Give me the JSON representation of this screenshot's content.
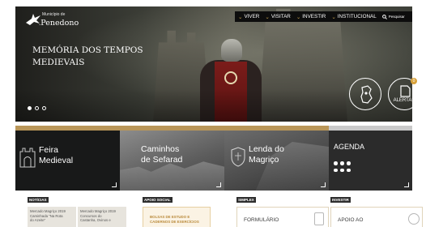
{
  "header": {
    "logo_small": "Município de",
    "logo_name": "Penedono",
    "nav": [
      {
        "label": "VIVER"
      },
      {
        "label": "VISITAR"
      },
      {
        "label": "INVESTIR"
      },
      {
        "label": "INSTITUCIONAL"
      }
    ],
    "search_label": "Pesquisar"
  },
  "hero": {
    "title_line1": "MEMÓRIA DOS TEMPOS",
    "title_line2": "MEDIEVAIS",
    "slides": 3,
    "active_slide": 1,
    "alert_label": "ALERTAS",
    "alert_count": "0"
  },
  "tiles": [
    {
      "line1": "Feira",
      "line2": "Medieval"
    },
    {
      "line1": "Caminhos",
      "line2": "de Sefarad"
    },
    {
      "line1": "Lenda do",
      "line2": "Magriço"
    },
    {
      "line1": "AGENDA",
      "line2": ""
    }
  ],
  "sections": {
    "news_label": "NOTÍCIAS",
    "news": [
      {
        "line1": "Mercado Magriço 2019",
        "line2": "Caminhada \"Na Rota",
        "line3": "do Azeite\""
      },
      {
        "line1": "Mercado Magriço 2019",
        "line2": "Concursos do",
        "line3": "Castanha, Ovinos e"
      }
    ],
    "social_label": "APOIO SOCIAL",
    "social_card_line1": "BOLSAS DE ESTUDO E",
    "social_card_line2": "CADERNOS DE EXERCÍCIOS",
    "simplex_label": "SIMPLEX",
    "simplex_card": "FORMULÁRIO",
    "investir_label": "INVESTIR",
    "investir_card": "APOIO AO"
  },
  "colors": {
    "accent_gold": "#b99658",
    "nav_chevron": "#c9a34f",
    "dark": "#181919"
  }
}
